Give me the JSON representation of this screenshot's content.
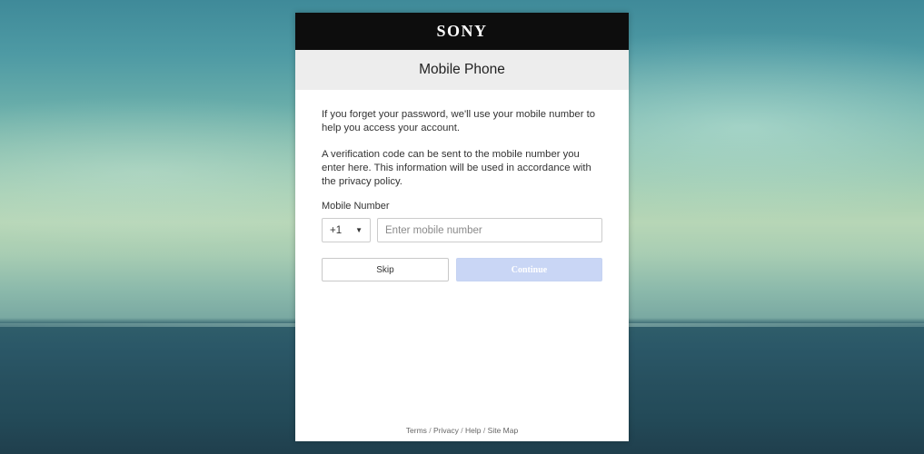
{
  "brand": {
    "logo_text": "SONY",
    "bar_color": "#0d0d0d"
  },
  "page": {
    "title": "Mobile Phone"
  },
  "content": {
    "paragraph_1": "If you forget your password, we'll use your mobile number to help you access your account.",
    "paragraph_2": "A verification code can be sent to the mobile number you enter here. This information will be used in accordance with the privacy policy."
  },
  "form": {
    "mobile_label": "Mobile Number",
    "country_code": "+1",
    "mobile_value": "",
    "mobile_placeholder": "Enter mobile number"
  },
  "buttons": {
    "skip_label": "Skip",
    "continue_label": "Continue",
    "continue_color": "#c9d6f5"
  },
  "footer": {
    "links": [
      "Terms",
      "Privacy",
      "Help",
      "Site Map"
    ],
    "separator": "/"
  }
}
